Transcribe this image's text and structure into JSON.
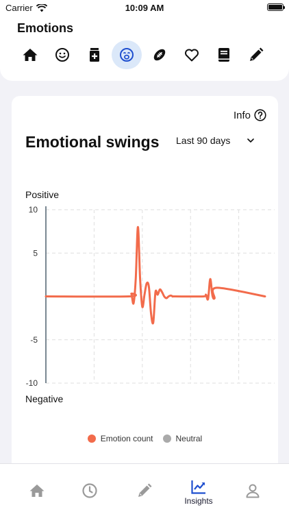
{
  "status_bar": {
    "carrier": "Carrier",
    "time": "10:09 AM"
  },
  "header": {
    "title": "Emotions",
    "categories": [
      "home-icon",
      "smiley-icon",
      "medication-icon",
      "anxious-face-icon",
      "football-icon",
      "heart-icon",
      "journal-icon",
      "pencil-icon"
    ],
    "active_category": "anxious-face-icon"
  },
  "card": {
    "info_label": "Info",
    "title": "Emotional swings",
    "range_label": "Last 90 days",
    "positive_label": "Positive",
    "negative_label": "Negative",
    "legend": [
      {
        "label": "Emotion count",
        "color": "#f26b4b"
      },
      {
        "label": "Neutral",
        "color": "#aaaaaa"
      }
    ]
  },
  "chart_data": {
    "type": "line",
    "title": "Emotional swings",
    "xlabel": "",
    "ylabel": "",
    "ylim": [
      -10,
      10
    ],
    "yticks": [
      10,
      5,
      -5,
      -10
    ],
    "grid": true,
    "series": [
      {
        "name": "Emotion count",
        "color": "#f26b4b",
        "x": [
          0,
          0.38,
          0.39,
          0.4,
          0.41,
          0.42,
          0.43,
          0.44,
          0.45,
          0.46,
          0.47,
          0.48,
          0.49,
          0.5,
          0.51,
          0.52,
          0.53,
          0.54,
          0.55,
          0.56,
          0.57,
          0.58,
          0.59,
          0.72,
          0.73,
          0.74,
          0.75,
          0.76,
          0.77,
          0.78,
          1
        ],
        "values": [
          0,
          0,
          0.3,
          -0.8,
          2,
          8,
          2,
          -1.2,
          0.2,
          1.5,
          1.1,
          -2,
          -3,
          0.5,
          0.2,
          0.8,
          0.5,
          0,
          -0.2,
          0,
          0.1,
          0,
          0,
          0,
          0.2,
          -0.3,
          2,
          0.1,
          -0.2,
          1,
          0
        ]
      }
    ]
  },
  "tabbar": {
    "tabs": [
      {
        "icon": "home-icon",
        "label": ""
      },
      {
        "icon": "clock-icon",
        "label": ""
      },
      {
        "icon": "pencil-icon",
        "label": ""
      },
      {
        "icon": "insights-icon",
        "label": "Insights"
      },
      {
        "icon": "profile-icon",
        "label": ""
      }
    ],
    "active_index": 3
  },
  "colors": {
    "accent": "#1f4fcf",
    "line": "#f26b4b",
    "axis": "#6b7a86",
    "grid": "#dedede",
    "inactive_icon": "#9a9a9a"
  }
}
